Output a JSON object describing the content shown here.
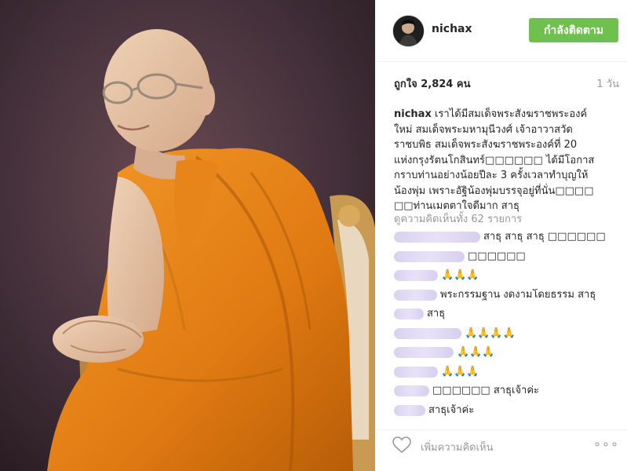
{
  "header": {
    "username": "nichax",
    "follow_label": "กำลังติดตาม",
    "avatar_icon": "profile-avatar"
  },
  "post": {
    "likes": "ถูกใจ 2,824 คน",
    "time": "1 วัน",
    "caption_user": "nichax",
    "caption_lines": [
      "เราได้มีสมเด็จพระสังฆราชพระองค์",
      "ใหม่ สมเด็จพระมหามุนีวงศ์ เจ้าอาวาสวัด",
      "ราชบพิธ สมเด็จพระสังฆราชพระองค์ที่ 20",
      "แห่งกรุงรัตนโกสินทร์□□□□□□ ได้มีโอกาส",
      "กราบท่านอย่างน้อยปีละ 3 ครั้งเวลาทำบุญให้",
      "น้องพุ่ม เพราะอัฐิน้องพุ่มบรรจุอยู่ที่นั่น□□□□",
      "□□ท่านเมตตาใจดีมาก สาธุ"
    ],
    "view_all": "ดูความคิดเห็นทั้ง 62 รายการ"
  },
  "comments": [
    {
      "text": "สาธุ สาธุ สาธุ □□□□□□"
    },
    {
      "text": "□□□□□□"
    },
    {
      "text": "🙏🙏🙏"
    },
    {
      "text": "พระกรรมฐาน งดงามโดยธรรม สาธุ"
    },
    {
      "text": "สาธุ"
    },
    {
      "text": "🙏🙏🙏🙏"
    },
    {
      "text": "🙏🙏🙏"
    },
    {
      "text": "🙏🙏🙏"
    },
    {
      "text": "□□□□□□ สาธุเจ้าค่ะ"
    },
    {
      "text": "สาธุเจ้าค่ะ"
    }
  ],
  "footer": {
    "add_comment_placeholder": "เพิ่มความคิดเห็น",
    "like_icon": "heart-icon",
    "more_label": "∘∘∘"
  },
  "colors": {
    "follow_button": "#70c050",
    "robe": "#e07a12",
    "background": "#3e2a33"
  }
}
